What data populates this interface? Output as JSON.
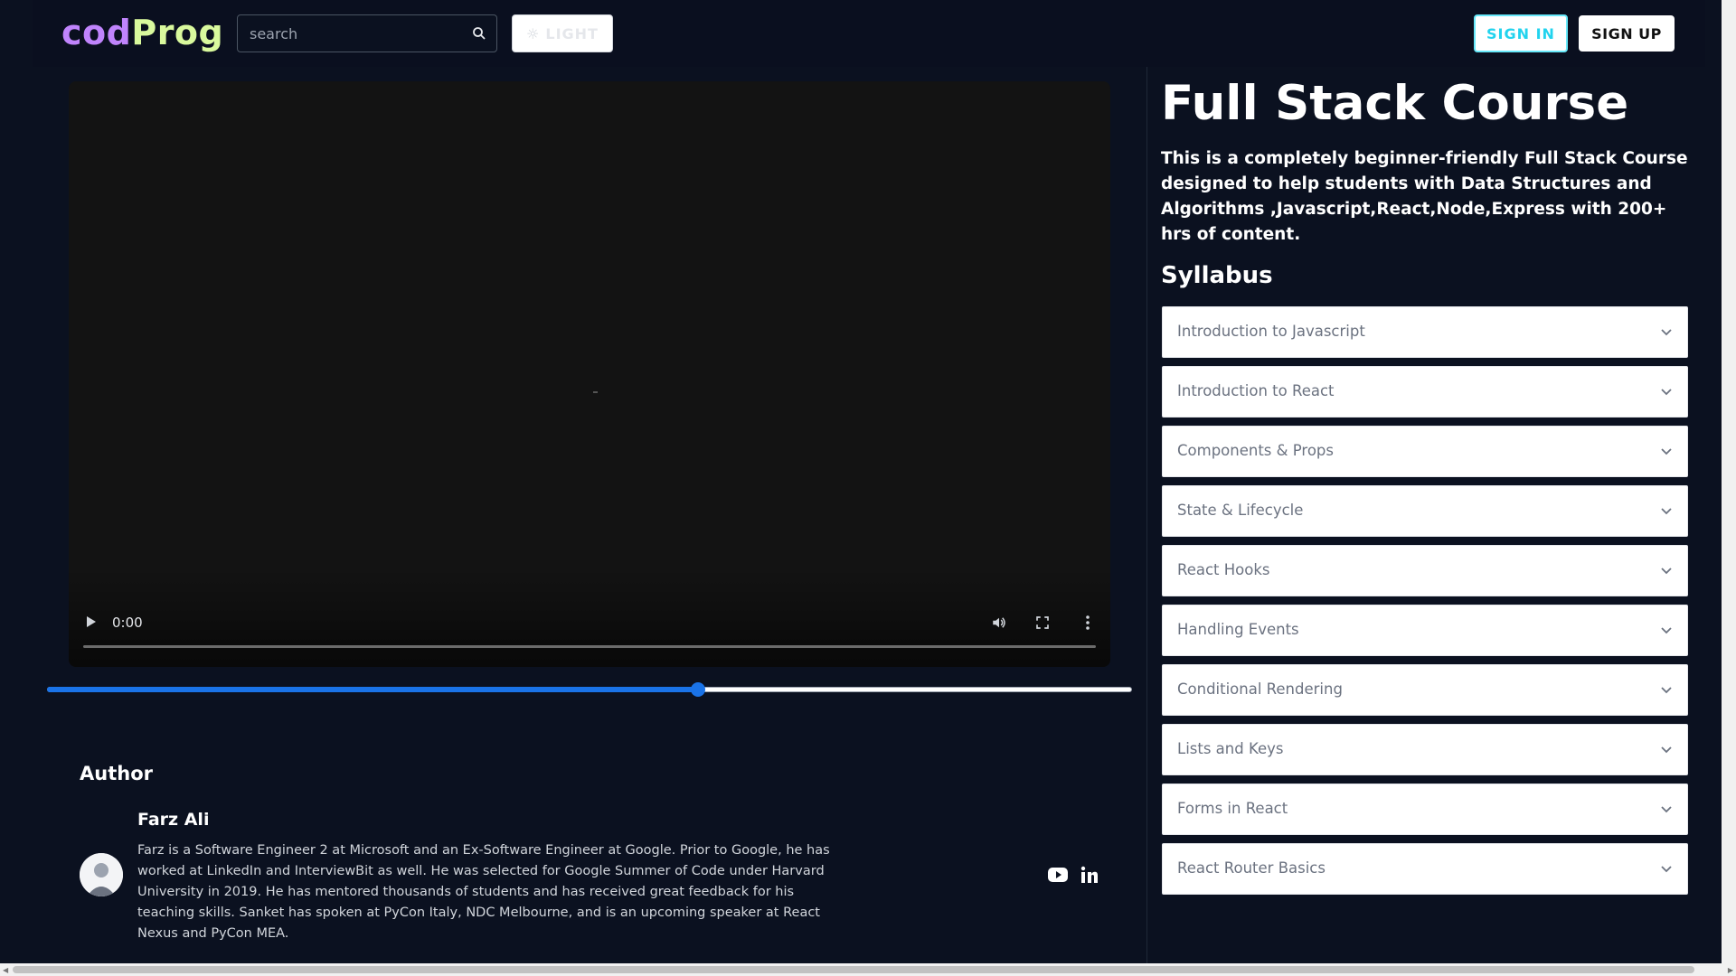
{
  "navbar": {
    "logo_part1": "cod",
    "logo_part2": "Prog",
    "search_placeholder": "search",
    "theme_button_label": "LIGHT",
    "signin_label": "SIGN IN",
    "signup_label": "SIGN UP"
  },
  "video": {
    "time": "0:00"
  },
  "progress_slider": {
    "value_fraction": 0.6
  },
  "author": {
    "heading": "Author",
    "name": "Farz Ali",
    "bio": "Farz is a Software Engineer 2 at Microsoft and an Ex-Software Engineer at Google. Prior to Google, he has worked at LinkedIn and InterviewBit as well. He was selected for Google Summer of Code under Harvard University in 2019. He has mentored thousands of students and has received great feedback for his teaching skills. Sanket has spoken at PyCon Italy, NDC Melbourne, and is an upcoming speaker at React Nexus and PyCon MEA."
  },
  "course": {
    "title": "Full Stack Course",
    "description": "This is a completely beginner-friendly Full Stack Course designed to help students with Data Structures and Algorithms ,Javascript,React,Node,Express with 200+ hrs of content.",
    "syllabus_heading": "Syllabus",
    "syllabus": [
      "Introduction to Javascript",
      "Introduction to React",
      "Components & Props",
      "State & Lifecycle",
      "React Hooks",
      "Handling Events",
      "Conditional Rendering",
      "Lists and Keys",
      "Forms in React",
      "React Router Basics"
    ]
  },
  "colors": {
    "background": "#0b1120",
    "logo_part1": "#c084fc",
    "logo_part2": "#d9f99d",
    "signin_accent": "#22d3ee",
    "slider_accent": "#1a73e8"
  },
  "icons": {
    "search": "search-icon",
    "theme": "sun-icon",
    "youtube": "youtube-icon",
    "linkedin": "linkedin-icon",
    "accordion": "chevron-down-icon"
  }
}
